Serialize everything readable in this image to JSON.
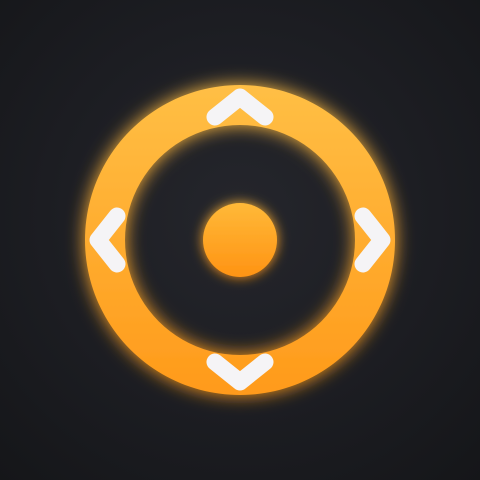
{
  "app_icon": {
    "description_free_tokens": true,
    "colors": {
      "background": "#1a1b20",
      "ring_top": "#ffbf45",
      "ring_bottom": "#ff9a1a",
      "ring_glow": "#ffa320",
      "center_top": "#ffb938",
      "center_bottom": "#ff9314",
      "arrow": "#f5f4f6"
    },
    "icons": {
      "ring": "dpad-ring",
      "center": "dpad-center-button",
      "up": "chevron-up-icon",
      "down": "chevron-down-icon",
      "left": "chevron-left-icon",
      "right": "chevron-right-icon"
    }
  }
}
